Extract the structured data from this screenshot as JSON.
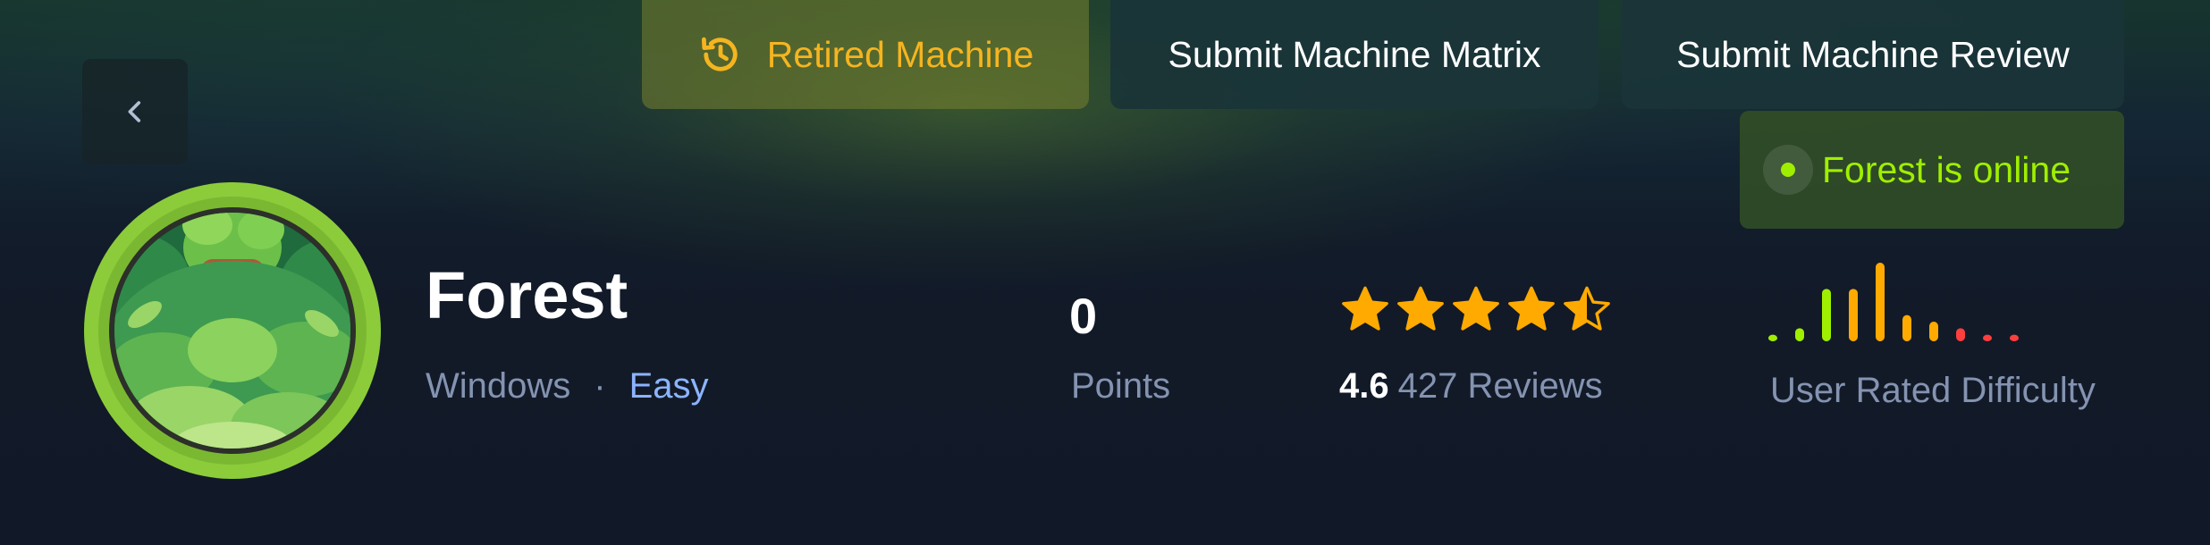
{
  "header": {
    "back_icon": "chevron-left-icon",
    "tabs": [
      {
        "label": "Retired Machine",
        "icon": "history-icon",
        "color": "#f5b51f"
      },
      {
        "label": "Submit Machine Matrix"
      },
      {
        "label": "Submit Machine Review"
      }
    ],
    "status": {
      "label": "Forest is online",
      "color": "#9fef00"
    }
  },
  "machine": {
    "name": "Forest",
    "os": "Windows",
    "separator": "·",
    "difficulty": "Easy",
    "difficulty_color": "#8cb4ff",
    "avatar_icon": "forest-avatar"
  },
  "stats": {
    "points": {
      "value": "0",
      "label": "Points"
    },
    "rating": {
      "average": "4.6",
      "reviews": "427 Reviews",
      "stars": 4.5,
      "star_color": "#ffaa00"
    },
    "user_difficulty": {
      "label": "User Rated Difficulty",
      "bars": [
        1,
        2,
        8,
        8,
        12,
        4,
        3,
        2,
        1,
        1
      ],
      "colors": [
        "#9fef00",
        "#9fef00",
        "#9fef00",
        "#ffaa00",
        "#ffaa00",
        "#ffaa00",
        "#ffaa00",
        "#ff3e3e",
        "#ff3e3e",
        "#ff3e3e"
      ]
    }
  }
}
